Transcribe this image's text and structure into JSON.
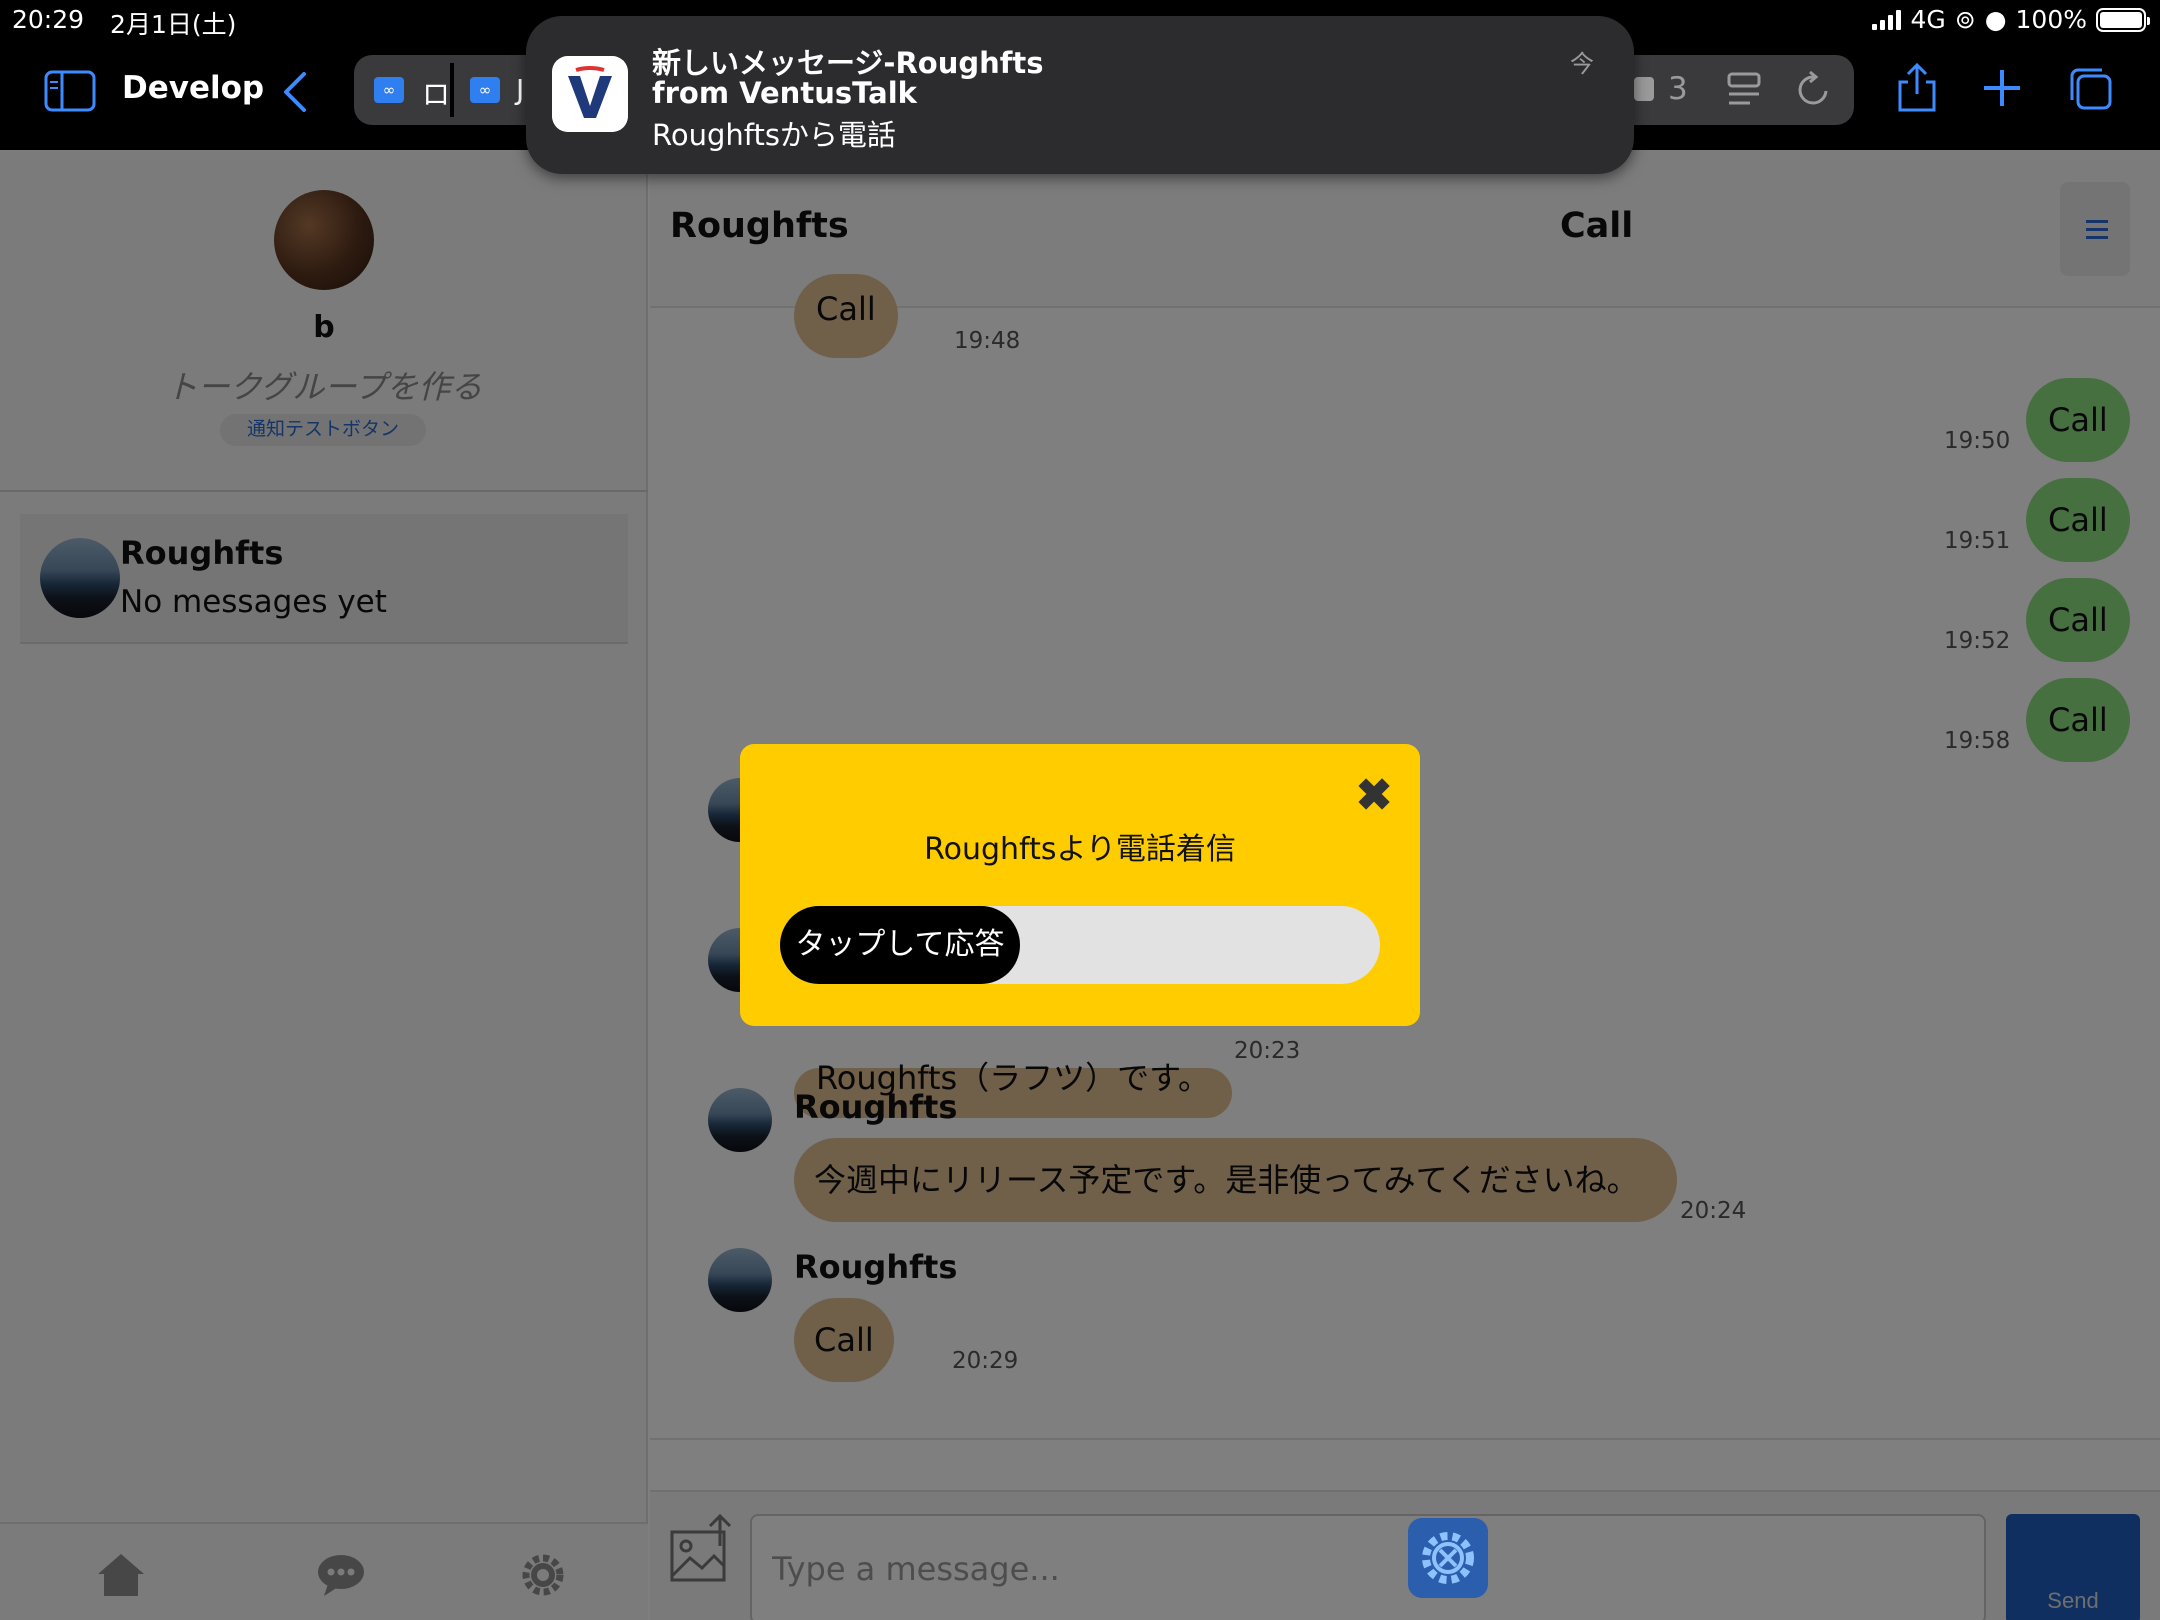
{
  "status_bar": {
    "time": "20:29",
    "date": "2月1日(土)",
    "network": "4G",
    "battery": "100%"
  },
  "browser": {
    "sidebar_title": "Develop",
    "tab_1_partial": "ロ",
    "tab_2_partial": "J",
    "tab_count": "3"
  },
  "notification": {
    "title": "新しいメッセージ-Roughfts",
    "subtitle": "from VentusTalk",
    "body": "Roughftsから電話",
    "time": "今",
    "app_icon_letter": "V"
  },
  "sidebar": {
    "profile_name": "b",
    "create_group": "トークグループを作る",
    "notify_test_button": "通知テストボタン",
    "chats": [
      {
        "name": "Roughfts",
        "preview": "No messages yet"
      }
    ]
  },
  "chat": {
    "header_name": "Roughfts",
    "header_action": "Call",
    "messages": [
      {
        "direction": "in",
        "text": "Call",
        "time": "19:48"
      },
      {
        "direction": "out",
        "text": "Call",
        "time": "19:50"
      },
      {
        "direction": "out",
        "text": "Call",
        "time": "19:51"
      },
      {
        "direction": "out",
        "text": "Call",
        "time": "19:52"
      },
      {
        "direction": "out",
        "text": "Call",
        "time": "19:58"
      },
      {
        "direction": "in",
        "text": "Roughfts（ラフツ）です。",
        "time": "20:23"
      },
      {
        "direction": "in",
        "sender": "Roughfts",
        "text": "今週中にリリース予定です。是非使ってみてくださいね。",
        "time": "20:24"
      },
      {
        "direction": "in",
        "sender": "Roughfts",
        "text": "Call",
        "time": "20:29"
      }
    ],
    "input_placeholder": "Type a message...",
    "send_label": "Send"
  },
  "call_modal": {
    "title": "Roughftsより電話着信",
    "answer_label": "タップして応答",
    "close_symbol": "✖"
  },
  "colors": {
    "incoming_bubble": "#e0c094",
    "outgoing_bubble": "#8ee183",
    "modal_background": "#ffcc00",
    "accent_blue": "#3d8bff"
  }
}
